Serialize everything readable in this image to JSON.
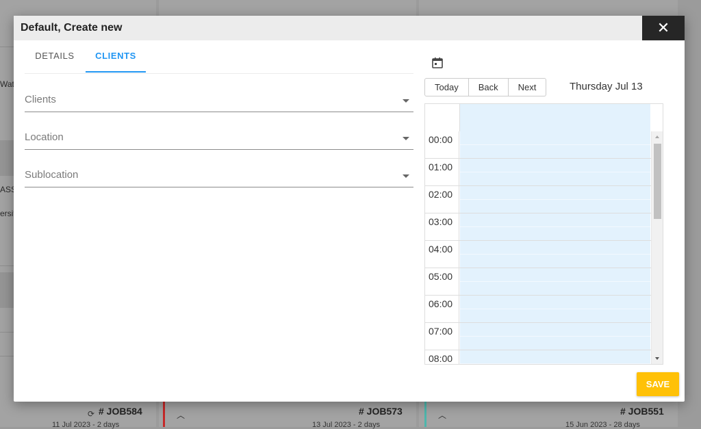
{
  "dialog": {
    "title": "Default, Create new",
    "close_glyph": "✕",
    "tabs": [
      {
        "label": "DETAILS",
        "active": false
      },
      {
        "label": "CLIENTS",
        "active": true
      }
    ],
    "fields": [
      {
        "label": "Clients"
      },
      {
        "label": "Location"
      },
      {
        "label": "Sublocation"
      }
    ],
    "save_label": "SAVE"
  },
  "calendar": {
    "icon": "calendar-icon",
    "toolbar": {
      "today": "Today",
      "back": "Back",
      "next": "Next"
    },
    "date_label": "Thursday Jul 13",
    "times": [
      "00:00",
      "01:00",
      "02:00",
      "03:00",
      "04:00",
      "05:00",
      "06:00",
      "07:00",
      "08:00"
    ]
  },
  "background": {
    "snippets": [
      "Wat",
      "ASS",
      "ersit"
    ],
    "jobs": [
      {
        "label": "# JOB584",
        "sub": "11 Jul 2023 - 2 days",
        "status_color": "#c62828",
        "sync_icon": "sync-icon"
      },
      {
        "label": "# JOB573",
        "sub": "13 Jul 2023 - 2 days",
        "status_color": "#4db6ac"
      },
      {
        "label": "# JOB551",
        "sub": "15 Jun 2023 - 28 days"
      }
    ]
  },
  "colors": {
    "accent": "#2196f3",
    "save": "#ffc107",
    "event_bg": "#e3f2fd",
    "header_bg": "#ececec",
    "close_bg": "#262626"
  }
}
